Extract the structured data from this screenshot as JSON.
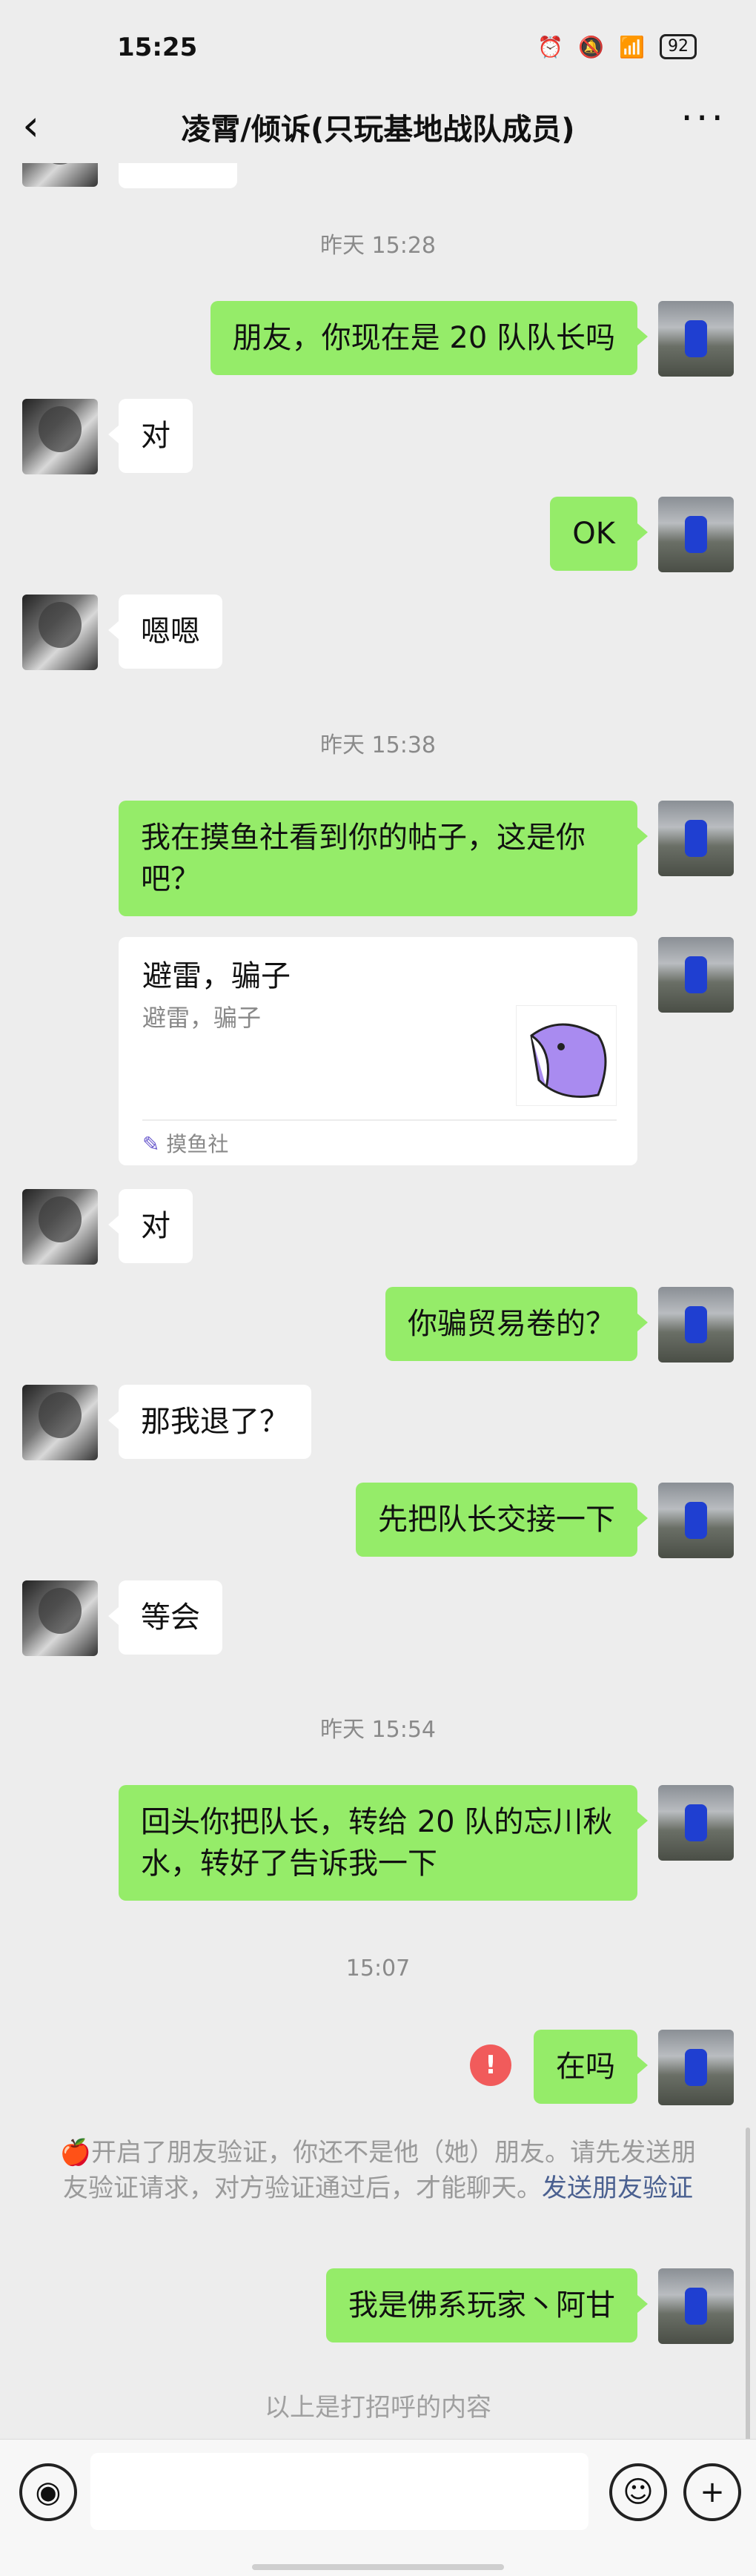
{
  "status_bar": {
    "time": "15:25",
    "battery": "92"
  },
  "header": {
    "title": "凌霄/倾诉(只玩基地战队成员)",
    "back_icon": "chevron-left-icon",
    "more_icon": "more-dots-icon"
  },
  "chat": {
    "ts1": "昨天 15:28",
    "m1": "朋友，你现在是 20 队队长吗",
    "m2": "对",
    "m3": "OK",
    "m4": "嗯嗯",
    "ts2": "昨天 15:38",
    "m5": "我在摸鱼社看到你的帖子，这是你吧？",
    "card": {
      "title": "避雷，骗子",
      "desc": "避雷，骗子",
      "source": "摸鱼社"
    },
    "m6": "对",
    "m7": "你骗贸易卷的？",
    "m8": "那我退了？",
    "m9": "先把队长交接一下",
    "m10": "等会",
    "ts3": "昨天 15:54",
    "m11": "回头你把队长，转给 20 队的忘川秋水，转好了告诉我一下",
    "ts4": "15:07",
    "m12": "在吗",
    "error_mark": "!",
    "notice_prefix": "🍎",
    "notice": "开启了朋友验证，你还不是他（她）朋友。请先发送朋友验证请求，对方验证通过后，才能聊天。",
    "notice_link": "发送朋友验证",
    "m13": "我是佛系玩家丶阿甘",
    "greeting_note": "以上是打招呼的内容"
  },
  "input_bar": {
    "voice_icon": "voice-icon",
    "emoji_icon": "emoji-icon",
    "plus_icon": "plus-icon"
  },
  "colors": {
    "me_bubble": "#95ec69",
    "background": "#ededed",
    "error": "#f15b5b",
    "link": "#4a6090"
  }
}
